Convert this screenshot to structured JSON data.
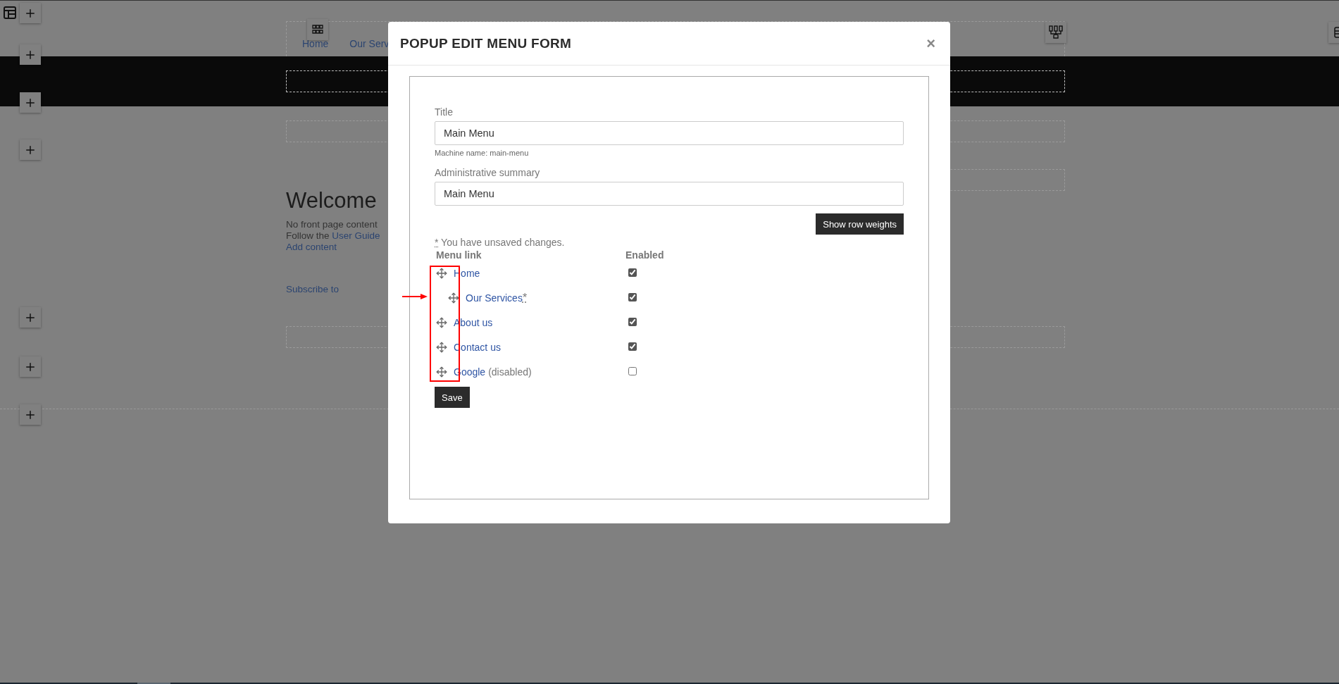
{
  "background_page": {
    "nav": [
      "Home",
      "Our Serv"
    ],
    "heading": "Welcome",
    "intro": "No front page content",
    "guide_prefix": "Follow the",
    "guide_link": "User Guide",
    "add_link": "Add content",
    "subscribe_link": "Subscribe to"
  },
  "modal": {
    "title": "POPUP EDIT MENU FORM",
    "close": "×",
    "fields": [
      {
        "label": "Title",
        "value": "Main Menu",
        "description": "Machine name: main-menu"
      },
      {
        "label": "Administrative summary",
        "value": "Main Menu"
      }
    ],
    "row_weights_button": "Show row weights",
    "unsaved_notice": {
      "mark": "*",
      "text": "You have unsaved changes."
    },
    "table": {
      "columns": [
        "Menu link",
        "Enabled"
      ],
      "rows": [
        {
          "title": "Home",
          "enabled": true,
          "children": [
            {
              "title": "Our Services",
              "mark": "*",
              "enabled": true
            }
          ]
        },
        {
          "title": "About us",
          "enabled": true
        },
        {
          "title": "Contact us",
          "enabled": true
        },
        {
          "title": "Google",
          "note": "(disabled)",
          "enabled": false
        }
      ]
    },
    "save_button": "Save"
  }
}
